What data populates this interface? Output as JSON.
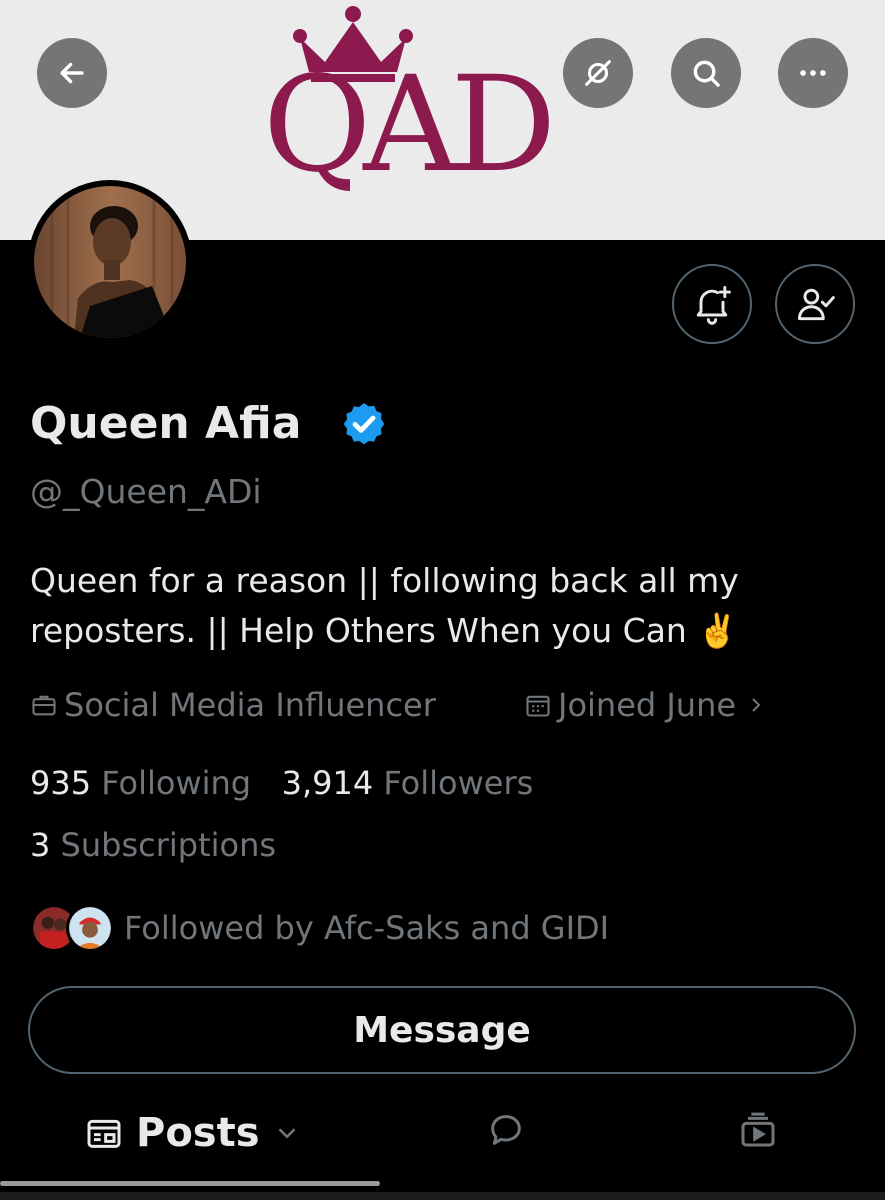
{
  "colors": {
    "banner_bg": "#ebebeb",
    "logo_maroon": "#8c1a4f",
    "background": "#000000",
    "text_primary": "#e7e9ea",
    "text_secondary": "#71767b",
    "verified_blue": "#1d9bf0",
    "border": "#536471"
  },
  "header": {
    "back_icon": "arrow-left-icon",
    "hide_icon": "eye-slash-icon",
    "search_icon": "search-icon",
    "more_icon": "more-horizontal-icon"
  },
  "banner": {
    "logo_text": "QAD"
  },
  "actions": {
    "notify_icon": "bell-plus-icon",
    "following_icon": "person-check-icon"
  },
  "profile": {
    "name": "Queen Afia",
    "handle": "@_Queen_ADi",
    "bio": "Queen for a reason || following back all my reposters. || Help Others When you Can ✌️",
    "occupation": "Social Media Influencer",
    "joined": "Joined June",
    "following_count": "935",
    "following_label": "Following",
    "followers_count": "3,914",
    "followers_label": "Followers",
    "subscriptions_count": "3",
    "subscriptions_label": "Subscriptions",
    "followed_by": "Followed by Afc-Saks and GIDI"
  },
  "message_button": {
    "label": "Message"
  },
  "tabs": {
    "posts_label": "Posts",
    "posts_icon": "list-icon",
    "replies_icon": "chat-bubble-icon",
    "media_icon": "video-stack-icon"
  }
}
